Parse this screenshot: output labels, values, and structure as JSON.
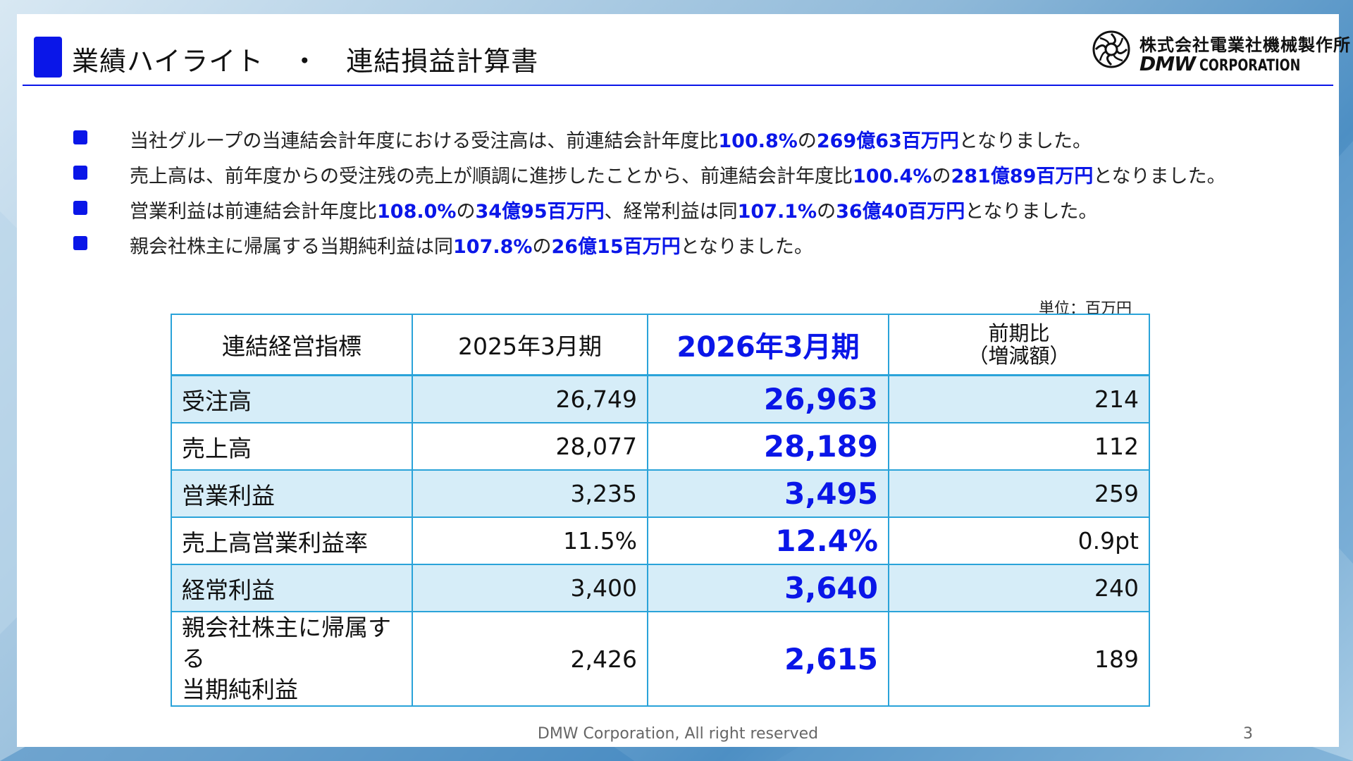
{
  "header": {
    "title": "業績ハイライト　・　連結損益計算書"
  },
  "logo": {
    "company_ja": "株式会社電業社機械製作所",
    "brand": "DMW",
    "corporation": "CORPORATION"
  },
  "bullets": [
    {
      "parts": [
        "当社グループの当連結会計年度における受注高は、前連結会計年度比",
        "100.8%",
        "の",
        "269億63百万円",
        "となりました。"
      ]
    },
    {
      "parts": [
        "売上高は、前年度からの受注残の売上が順調に進捗したことから、前連結会計年度比",
        "100.4%",
        "の",
        "281億89百万円",
        "となりました。"
      ]
    },
    {
      "parts": [
        "営業利益は前連結会計年度比",
        "108.0%",
        "の",
        "34億95百万円",
        "、経常利益は同",
        "107.1%",
        "の",
        "36億40百万円",
        "となりました。"
      ]
    },
    {
      "parts": [
        "親会社株主に帰属する当期純利益は同",
        "107.8%",
        "の",
        "26億15百万円",
        "となりました。"
      ]
    }
  ],
  "unit_label": "単位：百万円",
  "table": {
    "headers": {
      "metric": "連結経営指標",
      "prev": "2025年3月期",
      "curr": "2026年3月期",
      "diff_line1": "前期比",
      "diff_line2": "（増減額）"
    },
    "rows": [
      {
        "metric": "受注高",
        "prev": "26,749",
        "curr": "26,963",
        "diff": "214"
      },
      {
        "metric": "売上高",
        "prev": "28,077",
        "curr": "28,189",
        "diff": "112"
      },
      {
        "metric": "営業利益",
        "prev": "3,235",
        "curr": "3,495",
        "diff": "259"
      },
      {
        "metric": "売上高営業利益率",
        "prev": "11.5%",
        "curr": "12.4%",
        "diff": "0.9pt"
      },
      {
        "metric": "経常利益",
        "prev": "3,400",
        "curr": "3,640",
        "diff": "240"
      },
      {
        "metric_line1": "親会社株主に帰属する",
        "metric_line2": "当期純利益",
        "prev": "2,426",
        "curr": "2,615",
        "diff": "189"
      }
    ]
  },
  "footer": {
    "copyright": "DMW Corporation, All right reserved",
    "page_number": "3"
  },
  "colors": {
    "accent": "#0a16e8",
    "table_border": "#2aa3d9",
    "row_shade": "#d6edf8"
  }
}
